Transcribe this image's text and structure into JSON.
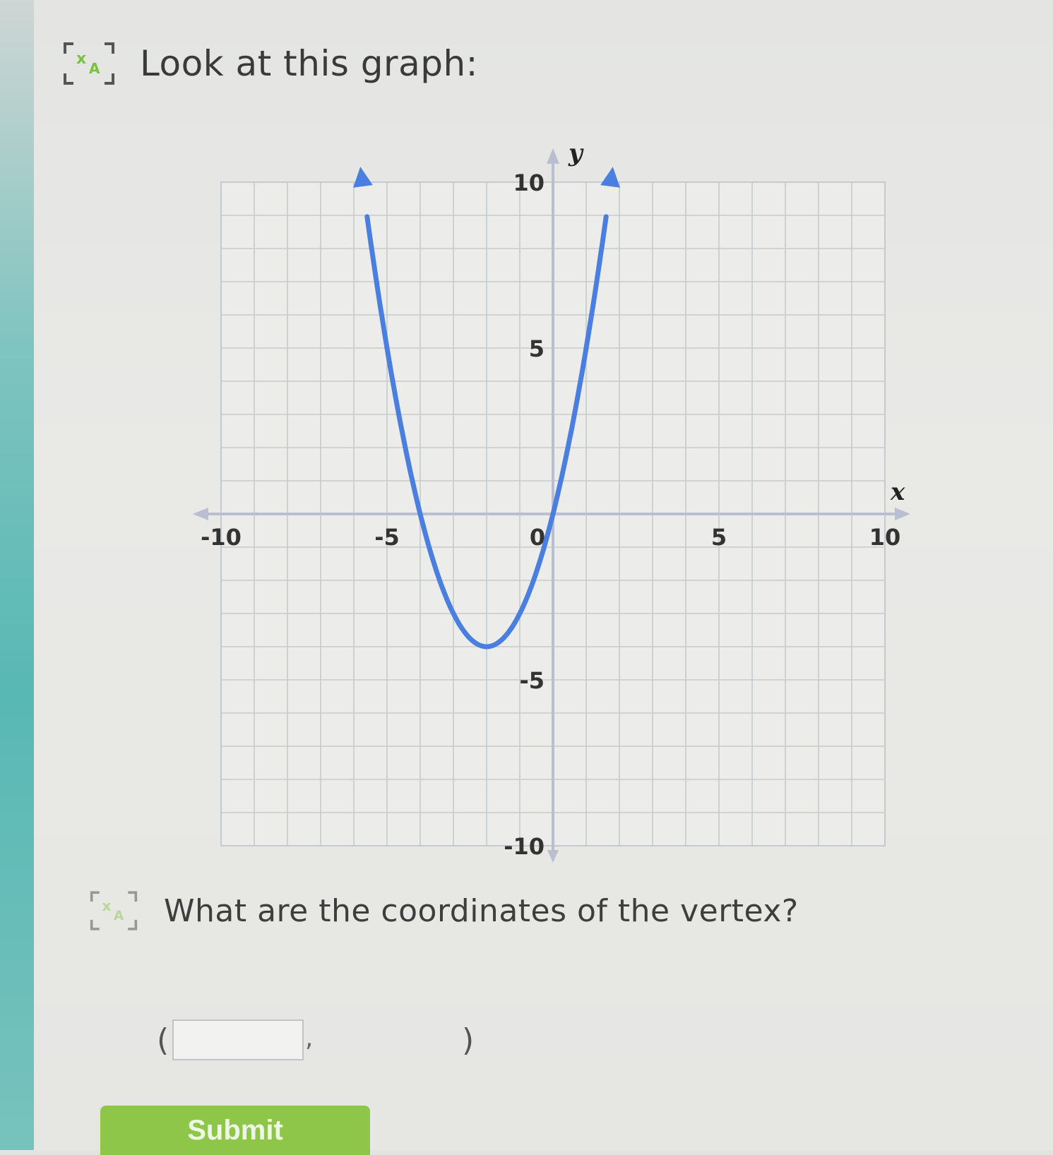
{
  "prompt": {
    "text": "Look at this graph:",
    "icon": "speaker-translate-icon"
  },
  "question": {
    "text": "What are the coordinates of the vertex?",
    "icon": "speaker-translate-icon"
  },
  "answer": {
    "open_paren": "(",
    "comma": ",",
    "close_paren": ")",
    "x_value": "",
    "y_value": ""
  },
  "submit": {
    "label": "Submit",
    "color": "#8ec64a"
  },
  "colors": {
    "curve": "#4a7fe0",
    "grid": "#c6cacc",
    "axis": "#b9bfd0",
    "icon_green": "#7cc043"
  },
  "chart_data": {
    "type": "line",
    "function": "y = x^2 + 4x",
    "x_range": [
      -10,
      10
    ],
    "y_range": [
      -10,
      10
    ],
    "grid": true,
    "xlabel": "x",
    "ylabel": "y",
    "x_ticks": [
      {
        "value": -10,
        "label": "-10"
      },
      {
        "value": -5,
        "label": "-5"
      },
      {
        "value": 0,
        "label": "0"
      },
      {
        "value": 5,
        "label": "5"
      },
      {
        "value": 10,
        "label": "10"
      }
    ],
    "y_ticks": [
      {
        "value": 10,
        "label": "10"
      },
      {
        "value": 5,
        "label": "5"
      },
      {
        "value": -5,
        "label": "-5"
      },
      {
        "value": -10,
        "label": "-10"
      }
    ],
    "curve_x_domain": [
      -5.6,
      1.6
    ],
    "key_points": [
      {
        "x": -4,
        "y": 0
      },
      {
        "x": -2,
        "y": -4
      },
      {
        "x": 0,
        "y": 0
      }
    ]
  }
}
